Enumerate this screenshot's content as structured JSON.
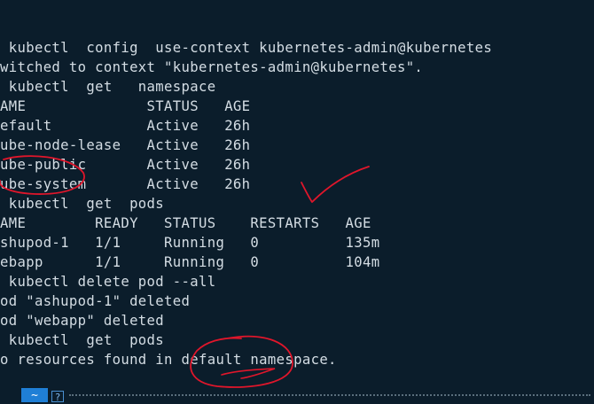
{
  "terminal": {
    "lines": [
      " kubectl  config  use-context kubernetes-admin@kubernetes",
      "witched to context \"kubernetes-admin@kubernetes\".",
      " kubectl  get   namespace",
      "AME              STATUS   AGE",
      "efault           Active   26h",
      "ube-node-lease   Active   26h",
      "ube-public       Active   26h",
      "ube-system       Active   26h",
      " kubectl  get  pods",
      "AME        READY   STATUS    RESTARTS   AGE",
      "shupod-1   1/1     Running   0          135m",
      "ebapp      1/1     Running   0          104m",
      " kubectl delete pod --all",
      "od \"ashupod-1\" deleted",
      "od \"webapp\" deleted",
      " kubectl  get  pods",
      "o resources found in default namespace."
    ]
  },
  "status_bar": {
    "home_tab": "~",
    "help_tab": "?"
  },
  "colors": {
    "background": "#0b1d2b",
    "text": "#d4dde4",
    "annotation": "#e0162b",
    "accent": "#1f7fd6"
  }
}
